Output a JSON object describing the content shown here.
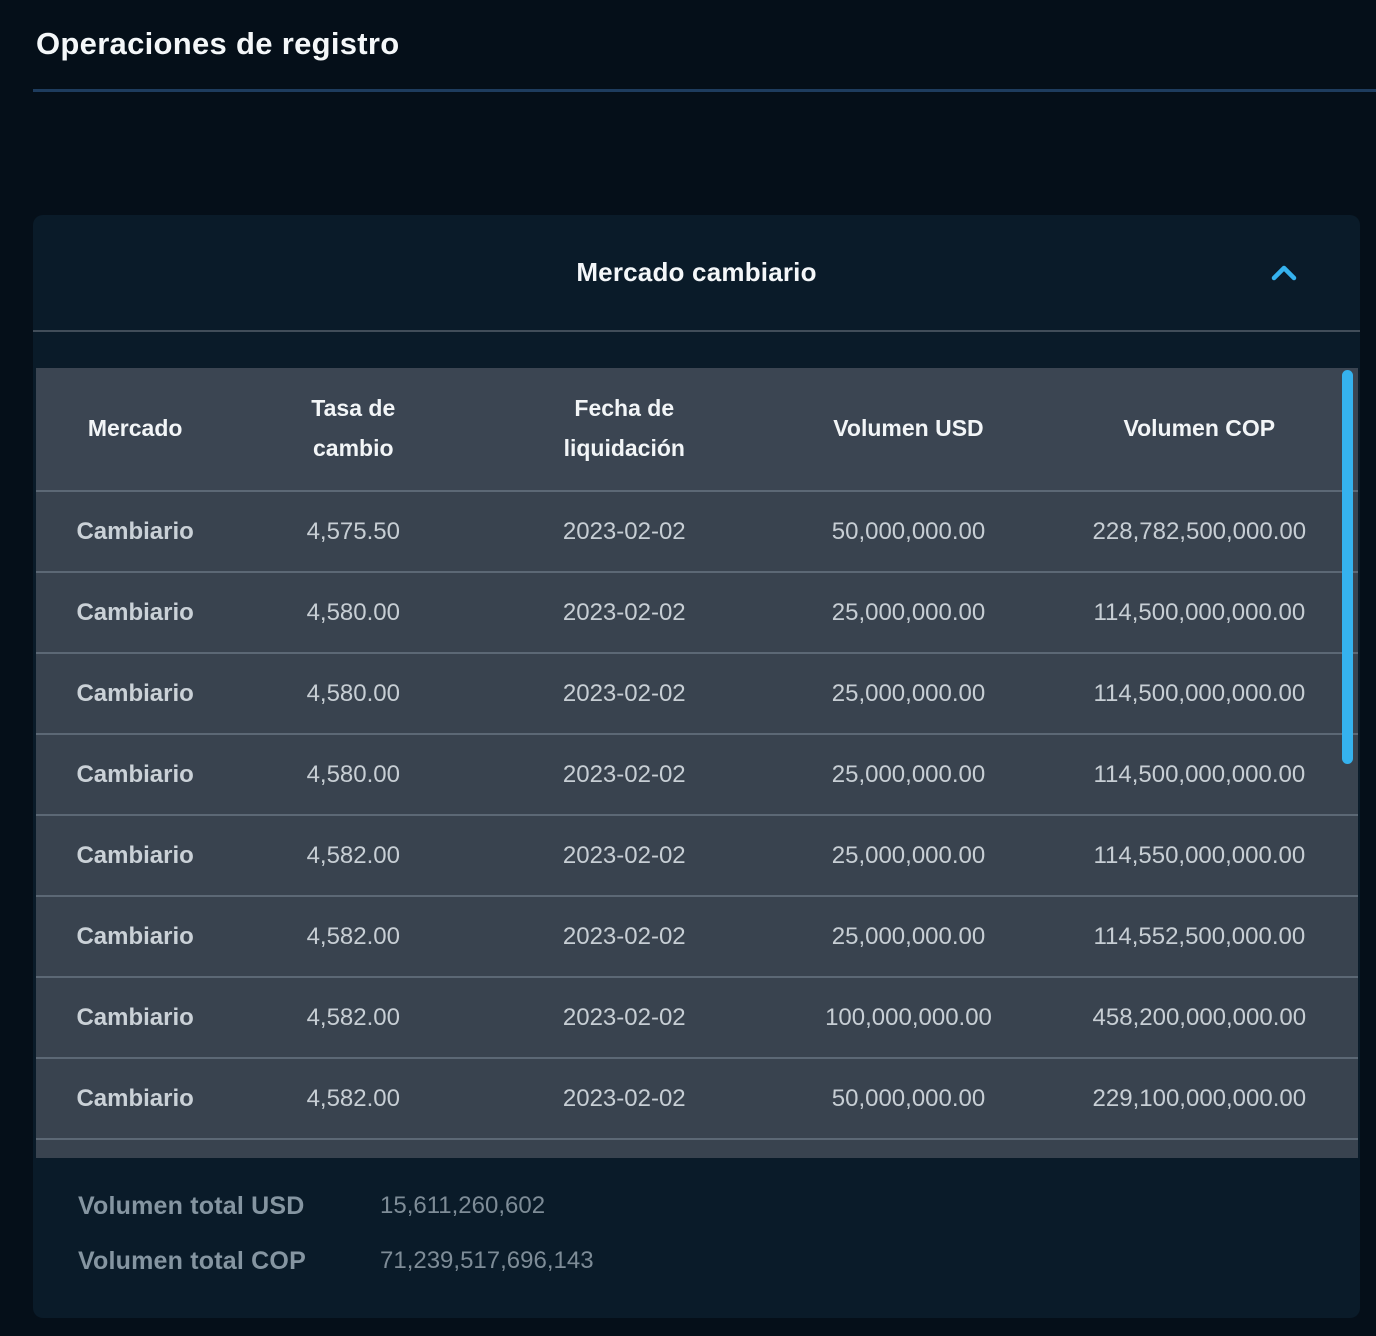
{
  "page": {
    "title": "Operaciones de registro"
  },
  "panel": {
    "title": "Mercado cambiario",
    "collapse_icon": "chevron-up-icon",
    "expanded": true
  },
  "table": {
    "columns": [
      "Mercado",
      "Tasa de cambio",
      "Fecha de liquidación",
      "Volumen USD",
      "Volumen COP"
    ],
    "rows": [
      [
        "Cambiario",
        "4,575.50",
        "2023-02-02",
        "50,000,000.00",
        "228,782,500,000.00"
      ],
      [
        "Cambiario",
        "4,580.00",
        "2023-02-02",
        "25,000,000.00",
        "114,500,000,000.00"
      ],
      [
        "Cambiario",
        "4,580.00",
        "2023-02-02",
        "25,000,000.00",
        "114,500,000,000.00"
      ],
      [
        "Cambiario",
        "4,580.00",
        "2023-02-02",
        "25,000,000.00",
        "114,500,000,000.00"
      ],
      [
        "Cambiario",
        "4,582.00",
        "2023-02-02",
        "25,000,000.00",
        "114,550,000,000.00"
      ],
      [
        "Cambiario",
        "4,582.00",
        "2023-02-02",
        "25,000,000.00",
        "114,552,500,000.00"
      ],
      [
        "Cambiario",
        "4,582.00",
        "2023-02-02",
        "100,000,000.00",
        "458,200,000,000.00"
      ],
      [
        "Cambiario",
        "4,582.00",
        "2023-02-02",
        "50,000,000.00",
        "229,100,000,000.00"
      ]
    ]
  },
  "totals": {
    "usd_label": "Volumen total USD",
    "usd_value": "15,611,260,602",
    "cop_label": "Volumen total COP",
    "cop_value": "71,239,517,696,143"
  },
  "colors": {
    "page_background": "#050f19",
    "panel_background": "#0a1b29",
    "table_header_background": "#3b4552",
    "row_background": "#39434f",
    "row_divider": "#5c6875",
    "accent_blue": "#35b2ee",
    "title_rule_blue": "#1e3c5e",
    "header_text": "#f2f5f7",
    "row_text": "#c7ced4",
    "muted_text": "#8595a1"
  }
}
